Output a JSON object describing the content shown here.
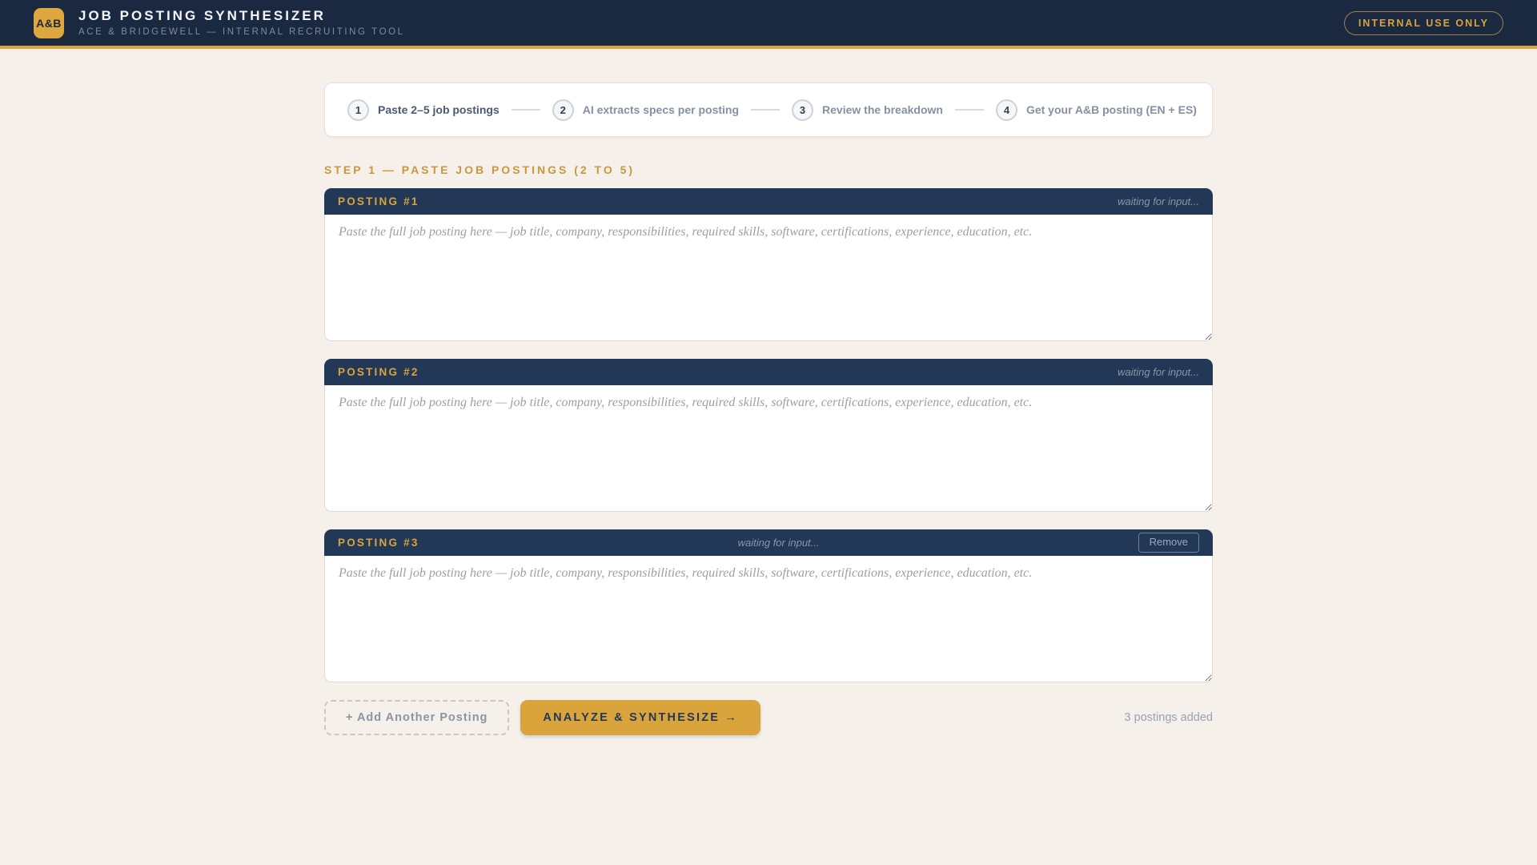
{
  "header": {
    "logo": "A&B",
    "title": "JOB POSTING SYNTHESIZER",
    "subtitle": "ACE & BRIDGEWELL — INTERNAL RECRUITING TOOL",
    "badge": "INTERNAL USE ONLY"
  },
  "stepper": {
    "steps": [
      {
        "num": "1",
        "label": "Paste 2–5 job postings",
        "active": true
      },
      {
        "num": "2",
        "label": "AI extracts specs per posting",
        "active": false
      },
      {
        "num": "3",
        "label": "Review the breakdown",
        "active": false
      },
      {
        "num": "4",
        "label": "Get your A&B posting (EN + ES)",
        "active": false
      }
    ]
  },
  "section": {
    "heading": "STEP 1 — PASTE JOB POSTINGS (2 TO 5)"
  },
  "postings": [
    {
      "title": "POSTING #1",
      "status": "waiting for input...",
      "value": "",
      "placeholder": "Paste the full job posting here — job title, company, responsibilities, required skills, software, certifications, experience, education, etc."
    },
    {
      "title": "POSTING #2",
      "status": "waiting for input...",
      "value": "",
      "placeholder": "Paste the full job posting here — job title, company, responsibilities, required skills, software, certifications, experience, education, etc."
    },
    {
      "title": "POSTING #3",
      "status": "waiting for input...",
      "value": "",
      "remove_label": "Remove",
      "placeholder": "Paste the full job posting here — job title, company, responsibilities, required skills, software, certifications, experience, education, etc."
    }
  ],
  "actions": {
    "add_button": "+ Add Another Posting",
    "analyze_button": "ANALYZE & SYNTHESIZE →",
    "count_text": "3 postings added"
  },
  "colors": {
    "header_navy": "#1b2940",
    "card_navy": "#233856",
    "accent_gold": "#d9a43c",
    "heading_gold": "#c9973f",
    "page_background": "#f5f1ea",
    "muted_text": "#8b95a9"
  }
}
